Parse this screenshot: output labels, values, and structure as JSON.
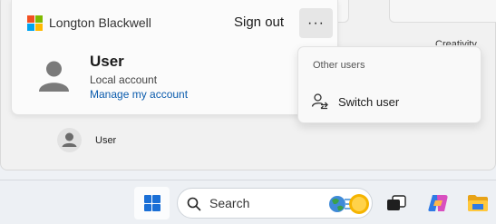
{
  "account": {
    "org_name": "Longton Blackwell",
    "sign_out_label": "Sign out",
    "more_label": "···",
    "user_name": "User",
    "account_type": "Local account",
    "manage_link": "Manage my account",
    "brand_colors": [
      "#f25022",
      "#7fba00",
      "#00a4ef",
      "#ffb900"
    ]
  },
  "other_users_menu": {
    "header": "Other users",
    "switch_user_label": "Switch user",
    "switch_user_icon": "switch-user-icon"
  },
  "start_menu": {
    "partial_label": "Creativity",
    "user_row_label": "User"
  },
  "taskbar": {
    "search_placeholder": "Search",
    "accent_color": "#1a6fd6",
    "apps": [
      "start",
      "search",
      "task-view",
      "copilot",
      "file-explorer"
    ]
  }
}
